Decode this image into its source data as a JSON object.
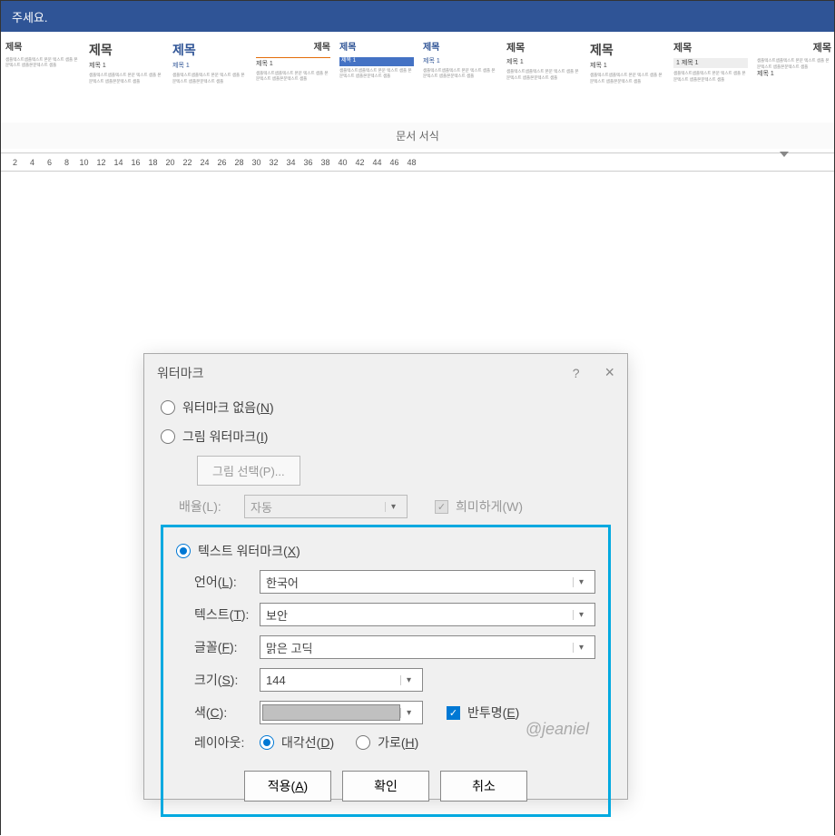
{
  "title_bar": "주세요.",
  "styles": {
    "label": "제목",
    "sublabel": "제목 1",
    "filler": "샘플텍스트샘플텍스트 본문 텍스트 샘플 본문텍스트 샘플본문텍스트 샘플"
  },
  "ribbon_group": "문서 서식",
  "ruler_ticks": [
    "2",
    "4",
    "6",
    "8",
    "10",
    "12",
    "14",
    "16",
    "18",
    "20",
    "22",
    "24",
    "26",
    "28",
    "30",
    "32",
    "34",
    "36",
    "38",
    "40",
    "42",
    "44",
    "46",
    "48"
  ],
  "dialog": {
    "title": "워터마크",
    "help": "?",
    "opt_none": "워터마크 없음(",
    "opt_none_u": "N",
    "opt_none_end": ")",
    "opt_picture": "그림 워터마크(",
    "opt_picture_u": "I",
    "opt_picture_end": ")",
    "btn_select_picture": "그림 선택(P)...",
    "scale_label": "배율(L):",
    "scale_value": "자동",
    "washout": "희미하게(W)",
    "opt_text": "텍스트 워터마크(",
    "opt_text_u": "X",
    "opt_text_end": ")",
    "language_label": "언어(",
    "language_u": "L",
    "language_end": "):",
    "language_value": "한국어",
    "text_label": "텍스트(",
    "text_u": "T",
    "text_end": "):",
    "text_value": "보안",
    "font_label": "글꼴(",
    "font_u": "F",
    "font_end": "):",
    "font_value": "맑은 고딕",
    "size_label": "크기(",
    "size_u": "S",
    "size_end": "):",
    "size_value": "144",
    "color_label": "색(",
    "color_u": "C",
    "color_end": "):",
    "semitransparent": "반투명(",
    "semitransparent_u": "E",
    "semitransparent_end": ")",
    "layout_label": "레이아웃:",
    "layout_diagonal": "대각선(",
    "layout_diagonal_u": "D",
    "layout_diagonal_end": ")",
    "layout_horizontal": "가로(",
    "layout_horizontal_u": "H",
    "layout_horizontal_end": ")",
    "btn_apply": "적용(",
    "btn_apply_u": "A",
    "btn_apply_end": ")",
    "btn_ok": "확인",
    "btn_cancel": "취소"
  },
  "credit": "@jeaniel"
}
